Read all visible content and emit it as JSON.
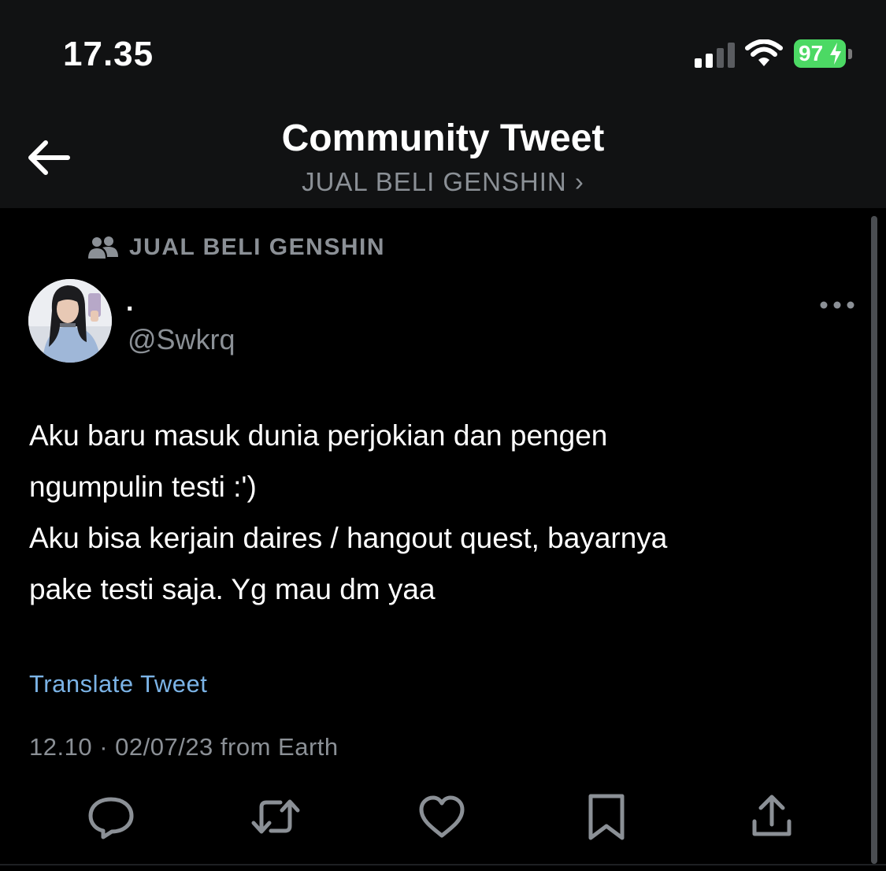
{
  "status_bar": {
    "time": "17.35",
    "battery": "97"
  },
  "header": {
    "title": "Community Tweet",
    "subtitle": "JUAL BELI GENSHIN ›"
  },
  "community": {
    "name": "JUAL BELI GENSHIN"
  },
  "author": {
    "display_name": ".",
    "handle": "@Swkrq"
  },
  "tweet": {
    "lines": [
      "Aku baru masuk dunia perjokian dan pengen",
      "ngumpulin testi :')",
      "Aku bisa kerjain daires / hangout quest, bayarnya",
      "pake testi saja. Yg mau dm yaa"
    ],
    "translate_label": "Translate Tweet",
    "meta": "12.10 · 02/07/23 from Earth"
  },
  "actions": [
    "reply-icon",
    "retweet-icon",
    "like-icon",
    "bookmark-icon",
    "share-icon"
  ],
  "colors": {
    "background": "#000000",
    "header_background": "#111213",
    "secondary_text": "#8b9096",
    "link": "#7bb3e6",
    "battery": "#4cd964"
  }
}
